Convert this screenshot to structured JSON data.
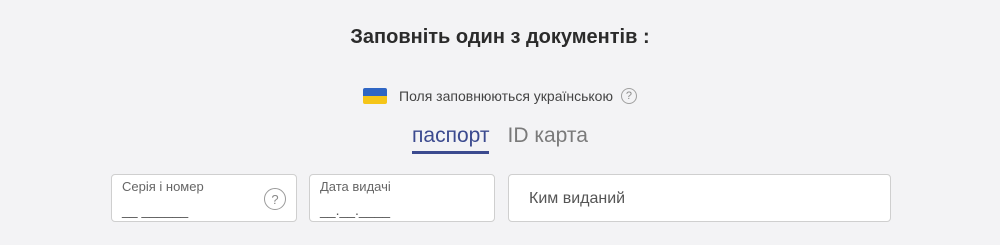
{
  "title": "Заповніть один з документів :",
  "language_note": {
    "text": "Поля заповнюються українською",
    "help_glyph": "?",
    "flag_colors": [
      "#2f66c4",
      "#f5c518"
    ]
  },
  "tabs": [
    {
      "label": "паспорт",
      "active": true
    },
    {
      "label": "ID карта",
      "active": false
    }
  ],
  "fields": {
    "series_number": {
      "label": "Серія і номер",
      "mask": "__ ______",
      "help_glyph": "?"
    },
    "issue_date": {
      "label": "Дата видачі",
      "mask": "__.__.____"
    },
    "issued_by": {
      "placeholder": "Ким виданий"
    }
  },
  "colors": {
    "accent": "#3b4a8f",
    "background": "#f3f3f5"
  }
}
